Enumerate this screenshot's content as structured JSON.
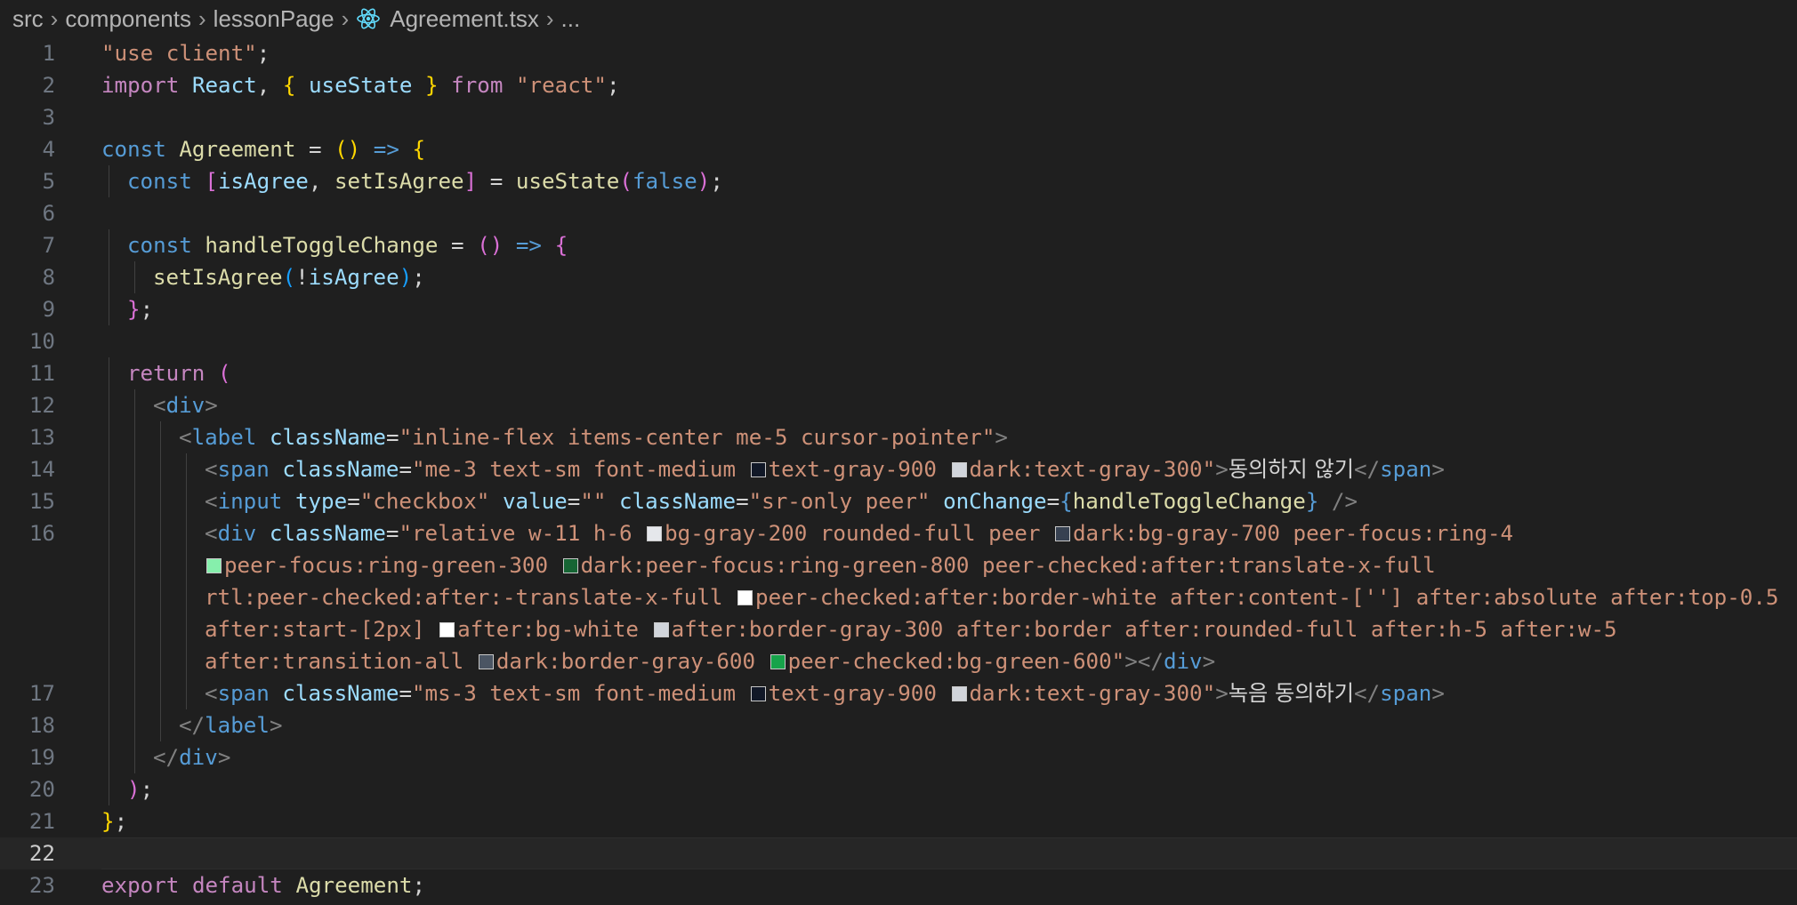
{
  "breadcrumb": {
    "segments": [
      "src",
      "components",
      "lessonPage"
    ],
    "file": "Agreement.tsx",
    "ellipsis": "..."
  },
  "editor": {
    "current_line": 22,
    "swatch_colors": {
      "gray_900": "#111827",
      "gray_300": "#d1d5db",
      "gray_200": "#e5e7eb",
      "gray_700": "#374151",
      "green_300": "#86efac",
      "green_800": "#166534",
      "white": "#ffffff",
      "gray_600": "#4b5563",
      "green_600": "#16a34a"
    },
    "lines": [
      {
        "n": "1",
        "tokens": [
          [
            "str",
            "\"use client\""
          ],
          [
            "pun",
            ";"
          ]
        ]
      },
      {
        "n": "2",
        "tokens": [
          [
            "kwc",
            "import "
          ],
          [
            "var",
            "React"
          ],
          [
            "pun",
            ", "
          ],
          [
            "b1",
            "{ "
          ],
          [
            "var",
            "useState"
          ],
          [
            "b1",
            " }"
          ],
          [
            "kwc",
            " from "
          ],
          [
            "str",
            "\"react\""
          ],
          [
            "pun",
            ";"
          ]
        ]
      },
      {
        "n": "3",
        "tokens": []
      },
      {
        "n": "4",
        "tokens": [
          [
            "kw",
            "const "
          ],
          [
            "fn",
            "Agreement"
          ],
          [
            "pun",
            " = "
          ],
          [
            "b1",
            "()"
          ],
          [
            "kw",
            " => "
          ],
          [
            "b1",
            "{"
          ]
        ]
      },
      {
        "n": "5",
        "tokens": [
          [
            "kw",
            "const "
          ],
          [
            "b2",
            "["
          ],
          [
            "var",
            "isAgree"
          ],
          [
            "pun",
            ", "
          ],
          [
            "fn",
            "setIsAgree"
          ],
          [
            "b2",
            "]"
          ],
          [
            "pun",
            " = "
          ],
          [
            "fn",
            "useState"
          ],
          [
            "b2",
            "("
          ],
          [
            "kw",
            "false"
          ],
          [
            "b2",
            ")"
          ],
          [
            "pun",
            ";"
          ]
        ]
      },
      {
        "n": "6",
        "tokens": []
      },
      {
        "n": "7",
        "tokens": [
          [
            "kw",
            "const "
          ],
          [
            "fn",
            "handleToggleChange"
          ],
          [
            "pun",
            " = "
          ],
          [
            "b2",
            "()"
          ],
          [
            "kw",
            " => "
          ],
          [
            "b2",
            "{"
          ]
        ]
      },
      {
        "n": "8",
        "tokens": [
          [
            "fn",
            "setIsAgree"
          ],
          [
            "b3",
            "("
          ],
          [
            "pun",
            "!"
          ],
          [
            "var",
            "isAgree"
          ],
          [
            "b3",
            ")"
          ],
          [
            "pun",
            ";"
          ]
        ]
      },
      {
        "n": "9",
        "tokens": [
          [
            "b2",
            "}"
          ],
          [
            "pun",
            ";"
          ]
        ]
      },
      {
        "n": "10",
        "tokens": []
      },
      {
        "n": "11",
        "tokens": [
          [
            "kwc",
            "return "
          ],
          [
            "b2",
            "("
          ]
        ]
      },
      {
        "n": "12",
        "tokens": [
          [
            "tagp",
            "<"
          ],
          [
            "tag",
            "div"
          ],
          [
            "tagp",
            ">"
          ]
        ]
      },
      {
        "n": "13",
        "tokens": [
          [
            "tagp",
            "<"
          ],
          [
            "tag",
            "label "
          ],
          [
            "attr",
            "className"
          ],
          [
            "pun",
            "="
          ],
          [
            "str",
            "\"inline-flex items-center me-5 cursor-pointer\""
          ],
          [
            "tagp",
            ">"
          ]
        ]
      },
      {
        "n": "14",
        "tokens": [
          [
            "tagp",
            "<"
          ],
          [
            "tag",
            "span "
          ],
          [
            "attr",
            "className"
          ],
          [
            "pun",
            "="
          ],
          [
            "str",
            "\"me-3 text-sm font-medium "
          ],
          [
            "sw",
            "gray_900"
          ],
          [
            "str",
            "text-gray-900 "
          ],
          [
            "sw",
            "gray_300"
          ],
          [
            "str",
            "dark:text-gray-300\""
          ],
          [
            "tagp",
            ">"
          ],
          [
            "txt",
            "동의하지 않기"
          ],
          [
            "tagp",
            "</"
          ],
          [
            "tag",
            "span"
          ],
          [
            "tagp",
            ">"
          ]
        ]
      },
      {
        "n": "15",
        "tokens": [
          [
            "tagp",
            "<"
          ],
          [
            "tag",
            "input "
          ],
          [
            "attr",
            "type"
          ],
          [
            "pun",
            "="
          ],
          [
            "str",
            "\"checkbox\" "
          ],
          [
            "attr",
            "value"
          ],
          [
            "pun",
            "="
          ],
          [
            "str",
            "\"\" "
          ],
          [
            "attr",
            "className"
          ],
          [
            "pun",
            "="
          ],
          [
            "str",
            "\"sr-only peer\" "
          ],
          [
            "attr",
            "onChange"
          ],
          [
            "pun",
            "="
          ],
          [
            "kw",
            "{"
          ],
          [
            "fn",
            "handleToggleChange"
          ],
          [
            "kw",
            "}"
          ],
          [
            "tagp",
            " />"
          ]
        ]
      },
      {
        "n": "16",
        "tokens": [
          [
            "tagp",
            "<"
          ],
          [
            "tag",
            "div "
          ],
          [
            "attr",
            "className"
          ],
          [
            "pun",
            "="
          ],
          [
            "str",
            "\"relative w-11 h-6 "
          ],
          [
            "sw",
            "gray_200"
          ],
          [
            "str",
            "bg-gray-200 rounded-full peer "
          ],
          [
            "sw",
            "gray_700"
          ],
          [
            "str",
            "dark:bg-gray-700 peer-focus:ring-4"
          ]
        ]
      },
      {
        "n": "",
        "tokens": [
          [
            "sw",
            "green_300"
          ],
          [
            "str",
            "peer-focus:ring-green-300 "
          ],
          [
            "sw",
            "green_800"
          ],
          [
            "str",
            "dark:peer-focus:ring-green-800 peer-checked:after:translate-x-full"
          ]
        ]
      },
      {
        "n": "",
        "tokens": [
          [
            "str",
            "rtl:peer-checked:after:-translate-x-full "
          ],
          [
            "sw",
            "white"
          ],
          [
            "str",
            "peer-checked:after:border-white after:content-[''] after:absolute after:top-0.5"
          ]
        ]
      },
      {
        "n": "",
        "tokens": [
          [
            "str",
            "after:start-[2px] "
          ],
          [
            "sw",
            "white"
          ],
          [
            "str",
            "after:bg-white "
          ],
          [
            "sw",
            "gray_300"
          ],
          [
            "str",
            "after:border-gray-300 after:border after:rounded-full after:h-5 after:w-5"
          ]
        ]
      },
      {
        "n": "",
        "tokens": [
          [
            "str",
            "after:transition-all "
          ],
          [
            "sw",
            "gray_600"
          ],
          [
            "str",
            "dark:border-gray-600 "
          ],
          [
            "sw",
            "green_600"
          ],
          [
            "str",
            "peer-checked:bg-green-600\""
          ],
          [
            "tagp",
            "></"
          ],
          [
            "tag",
            "div"
          ],
          [
            "tagp",
            ">"
          ]
        ]
      },
      {
        "n": "17",
        "tokens": [
          [
            "tagp",
            "<"
          ],
          [
            "tag",
            "span "
          ],
          [
            "attr",
            "className"
          ],
          [
            "pun",
            "="
          ],
          [
            "str",
            "\"ms-3 text-sm font-medium "
          ],
          [
            "sw",
            "gray_900"
          ],
          [
            "str",
            "text-gray-900 "
          ],
          [
            "sw",
            "gray_300"
          ],
          [
            "str",
            "dark:text-gray-300\""
          ],
          [
            "tagp",
            ">"
          ],
          [
            "txt",
            "녹음 동의하기"
          ],
          [
            "tagp",
            "</"
          ],
          [
            "tag",
            "span"
          ],
          [
            "tagp",
            ">"
          ]
        ]
      },
      {
        "n": "18",
        "tokens": [
          [
            "tagp",
            "</"
          ],
          [
            "tag",
            "label"
          ],
          [
            "tagp",
            ">"
          ]
        ]
      },
      {
        "n": "19",
        "tokens": [
          [
            "tagp",
            "</"
          ],
          [
            "tag",
            "div"
          ],
          [
            "tagp",
            ">"
          ]
        ]
      },
      {
        "n": "20",
        "tokens": [
          [
            "b2",
            ")"
          ],
          [
            "pun",
            ";"
          ]
        ]
      },
      {
        "n": "21",
        "tokens": [
          [
            "b1",
            "}"
          ],
          [
            "pun",
            ";"
          ]
        ]
      },
      {
        "n": "22",
        "tokens": []
      },
      {
        "n": "23",
        "tokens": [
          [
            "kwc",
            "export "
          ],
          [
            "kwc",
            "default "
          ],
          [
            "fn",
            "Agreement"
          ],
          [
            "pun",
            ";"
          ]
        ]
      }
    ]
  }
}
